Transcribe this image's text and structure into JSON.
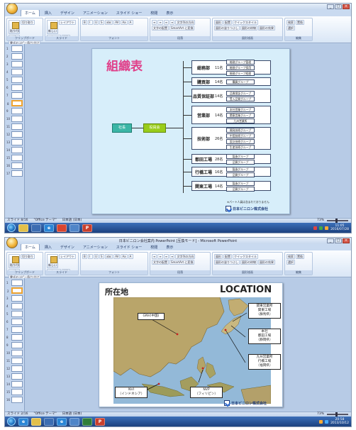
{
  "shot1": {
    "tabs": [
      "ホーム",
      "挿入",
      "デザイン",
      "アニメーション",
      "スライド ショー",
      "校閲",
      "表示"
    ],
    "ribbon_groups": [
      {
        "label": "クリップボード",
        "buttons": [
          "貼り付け",
          "切り取り",
          "コピー",
          "書式のコピー/貼り付け"
        ]
      },
      {
        "label": "スライド",
        "buttons": [
          "新しいスライド",
          "レイアウト",
          "リセット",
          "削除"
        ]
      },
      {
        "label": "フォント",
        "buttons": [
          "B",
          "I",
          "U",
          "S",
          "abc",
          "AV",
          "Aa",
          "A"
        ]
      },
      {
        "label": "段落",
        "buttons": [
          "≡",
          "≡",
          "≡",
          "≡",
          "文字列の方向",
          "文字の配置",
          "SmartArt に変換"
        ]
      },
      {
        "label": "図形描画",
        "buttons": [
          "図形",
          "配置",
          "クイックスタイル",
          "図形の塗りつぶし",
          "図形の枠線",
          "図形の効果"
        ]
      },
      {
        "label": "編集",
        "buttons": [
          "検索",
          "置換",
          "選択"
        ]
      }
    ],
    "slide": {
      "title": "組織表",
      "president": "社長",
      "board": "役員会",
      "departments": [
        {
          "name": "総務部",
          "count": "11名",
          "groups": [
            "総務グループ管理",
            "総務グループ採用",
            "総務グループ経理"
          ]
        },
        {
          "name": "購買部",
          "count": "14名",
          "groups": [
            "購買グループ"
          ]
        },
        {
          "name": "品質保証部",
          "count": "14名",
          "groups": [
            "品質保証グループ",
            "受入品質グループ"
          ]
        },
        {
          "name": "営業部",
          "count": "14名",
          "groups": [
            "本社営業グループ",
            "関東営業グループ",
            "九州営業所"
          ]
        },
        {
          "name": "技術部",
          "count": "26名",
          "groups": [
            "開発技術グループ",
            "中国技術グループ",
            "設計技術グループ",
            "生産技術グループ"
          ]
        },
        {
          "name": "都田工場",
          "count": "28名",
          "groups": [
            "製造グループ",
            "品質グループ"
          ]
        },
        {
          "name": "行橋工場",
          "count": "16名",
          "groups": [
            "製造グループ",
            "品質グループ"
          ]
        },
        {
          "name": "関東工場",
          "count": "14名",
          "groups": [
            "製造グループ",
            "品質グループ"
          ]
        }
      ],
      "note": "※パート人員は含まれておりません",
      "company": "日本ビニロン株式会社"
    },
    "status": {
      "slide": "スライド 8/16",
      "theme": "\"Office テーマ\"",
      "lang": "日本語 (日本)",
      "zoom": "73%"
    },
    "clock": {
      "time": "11:05",
      "date": "2016/07/28"
    }
  },
  "shot2": {
    "window_title": "日本ビニロン会社案内 PowerPoint [互換モード] - Microsoft PowerPoint",
    "tabs": [
      "ホーム",
      "挿入",
      "デザイン",
      "アニメーション",
      "スライド ショー",
      "校閲",
      "表示"
    ],
    "ribbon_groups": [
      {
        "label": "クリップボード",
        "buttons": [
          "貼り付け",
          "切り取り",
          "コピー",
          "書式のコピー/貼り付け"
        ]
      },
      {
        "label": "スライド",
        "buttons": [
          "新しいスライド",
          "レイアウト",
          "リセット",
          "削除"
        ]
      },
      {
        "label": "フォント",
        "buttons": [
          "B",
          "I",
          "U",
          "S",
          "abc",
          "AV",
          "Aa",
          "A"
        ]
      },
      {
        "label": "段落",
        "buttons": [
          "≡",
          "≡",
          "≡",
          "≡",
          "文字列の方向",
          "文字の配置",
          "SmartArt に変換"
        ]
      },
      {
        "label": "図形描画",
        "buttons": [
          "図形",
          "配置",
          "クイックスタイル",
          "図形の塗りつぶし",
          "図形の枠線",
          "図形の効果"
        ]
      },
      {
        "label": "編集",
        "buttons": [
          "検索",
          "置換",
          "選択"
        ]
      }
    ],
    "slide": {
      "title_jp": "所在地",
      "title_en": "LOCATION",
      "places": [
        {
          "key": "gnv",
          "text": "GNV(中国)"
        },
        {
          "key": "kanto",
          "text": "関東営業所\n関東工場\n（群馬県）"
        },
        {
          "key": "honsha",
          "text": "本社\n都田工場\n（静岡県）"
        },
        {
          "key": "kyushu",
          "text": "九州営業所\n行橋工場\n（福岡県）"
        },
        {
          "key": "nvi",
          "text": "NVI\n（インドネシア）"
        },
        {
          "key": "nvp",
          "text": "NVP\n（フィリピン）"
        }
      ],
      "company": "日本ビニロン株式会社"
    },
    "status": {
      "slide": "スライド 2/16",
      "theme": "\"Office テーマ\"",
      "lang": "日本語 (日本)",
      "zoom": "73%"
    },
    "clock": {
      "time": "20:58",
      "date": "2013/10/12"
    }
  }
}
